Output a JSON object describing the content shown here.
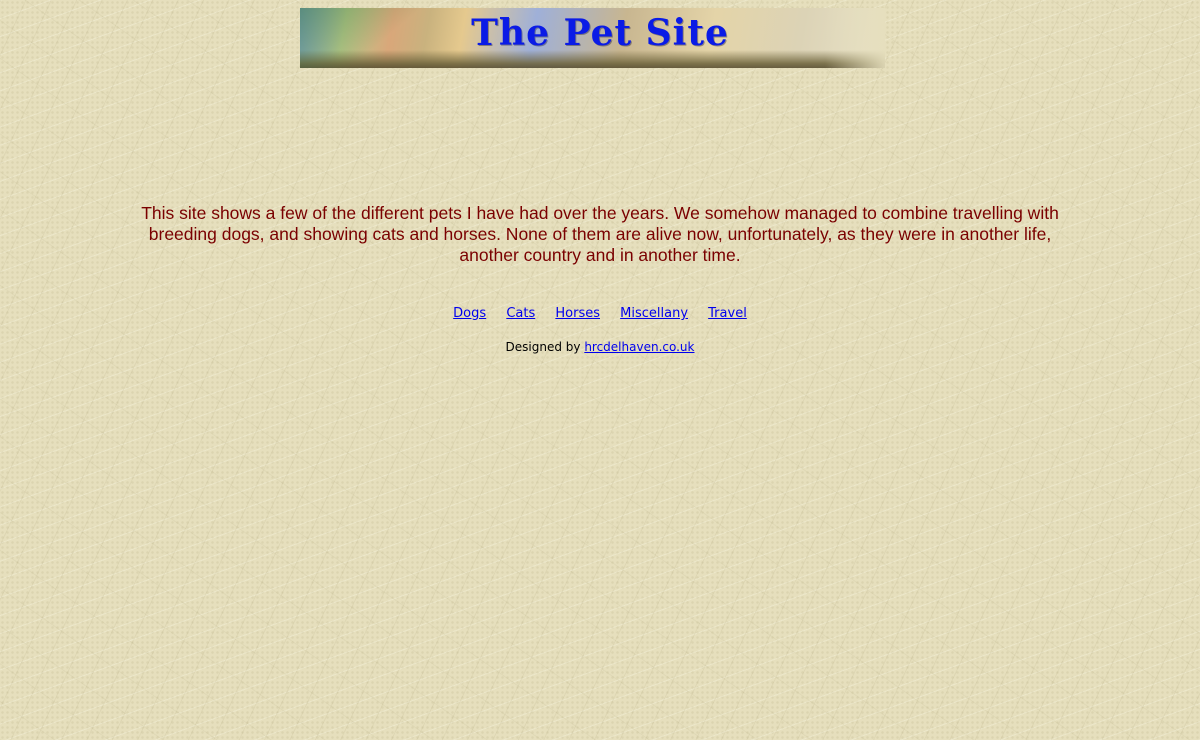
{
  "banner": {
    "title": "The Pet Site"
  },
  "intro": {
    "text": "This site shows a few of the different pets I have had over the years.  We somehow managed to combine travelling with breeding dogs, and showing cats and horses.  None of them are alive now, unfortunately, as they were in another life, another country and in another time."
  },
  "nav": {
    "links": [
      {
        "label": "Dogs"
      },
      {
        "label": "Cats"
      },
      {
        "label": "Horses"
      },
      {
        "label": "Miscellany"
      },
      {
        "label": "Travel"
      }
    ]
  },
  "footer": {
    "designed_by_label": "Designed by",
    "designer_link": "hrcdelhaven.co.uk"
  },
  "colors": {
    "background": "#e6dfbd",
    "intro_text": "#7a0000",
    "banner_title": "#0a1be6",
    "link": "#0000ee"
  }
}
